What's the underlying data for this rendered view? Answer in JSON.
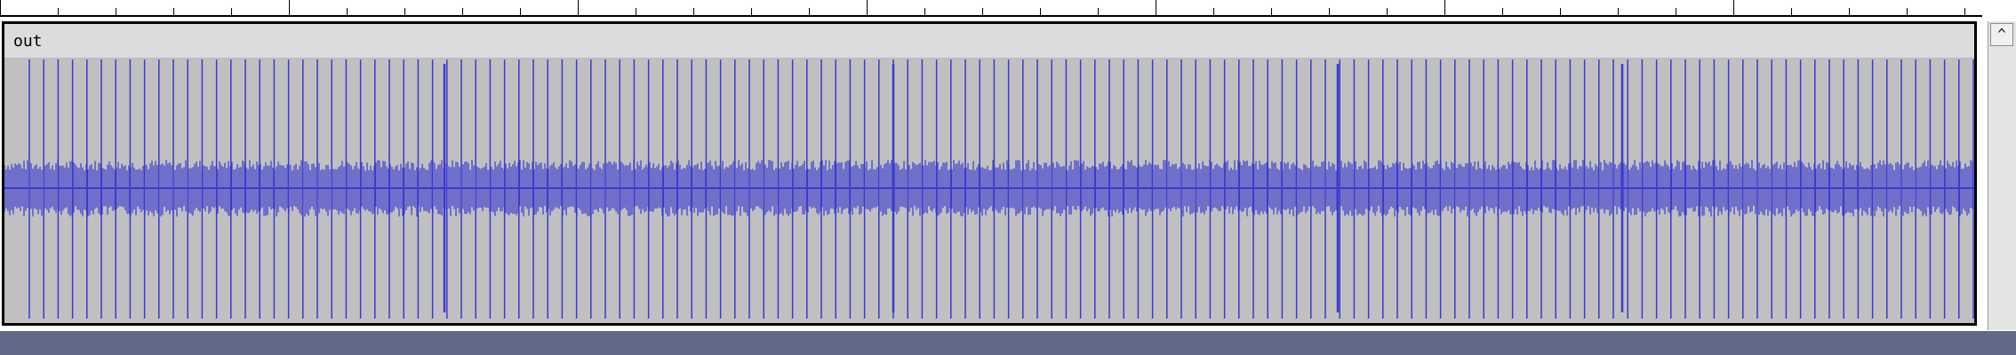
{
  "track": {
    "name": "out",
    "waveform_color": "#3a3ad0",
    "background_color": "#c0c0c0",
    "header_color": "#dcdcdc"
  },
  "scrollbar": {
    "up_icon": "chevron-up-icon"
  },
  "statusbar": {
    "color": "#606a88"
  }
}
